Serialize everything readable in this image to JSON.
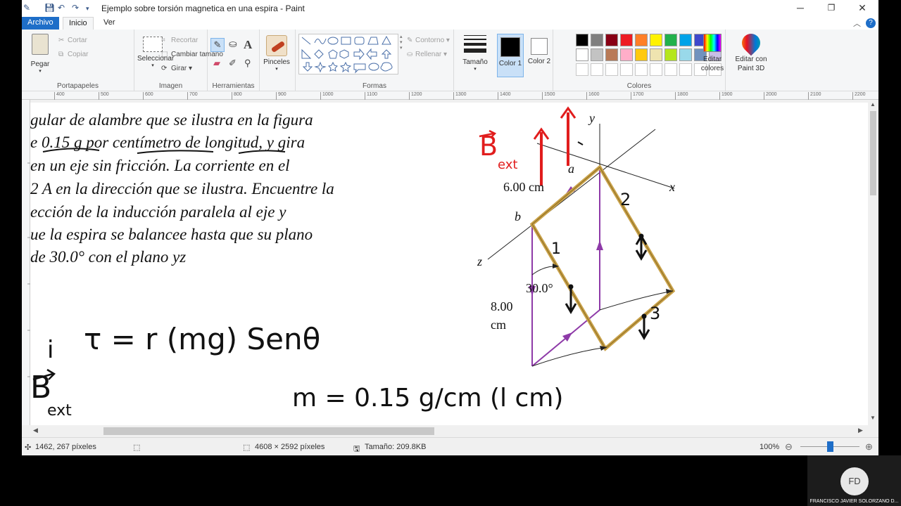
{
  "window": {
    "title": "Ejemplo sobre torsión magnetica en una espira - Paint",
    "minimize": "─",
    "maximize": "❐",
    "close": "✕"
  },
  "tabs": [
    "Archivo",
    "Inicio",
    "Ver"
  ],
  "ribbon": {
    "portapapeles": {
      "label": "Portapapeles",
      "pegar": "Pegar",
      "cortar": "Cortar",
      "copiar": "Copiar"
    },
    "imagen": {
      "label": "Imagen",
      "seleccionar": "Seleccionar",
      "recortar": "Recortar",
      "cambiar_tamano": "Cambiar tamaño",
      "girar": "Girar"
    },
    "herramientas": {
      "label": "Herramientas"
    },
    "pinceles": "Pinceles",
    "formas": {
      "label": "Formas",
      "contorno": "Contorno",
      "rellenar": "Rellenar"
    },
    "tamano": "Tamaño",
    "color1": "Color 1",
    "color2": "Color 2",
    "colores": {
      "label": "Colores",
      "editar_colores": "Editar colores"
    },
    "paint3d": "Editar con Paint 3D"
  },
  "palette": [
    "#000000",
    "#7f7f7f",
    "#880015",
    "#ed1c24",
    "#ff7f27",
    "#fff200",
    "#22b14c",
    "#00a2e8",
    "#3f48cc",
    "#a349a4",
    "#ffffff",
    "#c3c3c3",
    "#b97a57",
    "#ffaec9",
    "#ffc90e",
    "#efe4b0",
    "#b5e61d",
    "#99d9ea",
    "#7092be",
    "#c8bfe7"
  ],
  "ruler": [
    "400",
    "500",
    "600",
    "700",
    "800",
    "900",
    "1000",
    "1100",
    "1200",
    "1300",
    "1400",
    "1500",
    "1600",
    "1700",
    "1800",
    "1900",
    "2000",
    "2100",
    "2200"
  ],
  "problem": {
    "line1": "gular de alambre que se ilustra en la figura",
    "line2": "e 0.15 g por centímetro de longitud, y gira",
    "line3": "en un eje sin fricción. La corriente en el",
    "line4": "2 A en la dirección que se ilustra. Encuentre la",
    "line5": "ección de  la inducción        paralela al eje y",
    "line6": "ue la espira se balancee hasta que su plano",
    "line7": "de 30.0° con el plano yz"
  },
  "figure": {
    "y": "y",
    "x": "x",
    "z": "z",
    "a": "a",
    "b": "b",
    "dim1": "6.00 cm",
    "dim2a": "8.00",
    "dim2b": "cm",
    "angle": "30.0°",
    "bext_b": "B",
    "bext_sub": "ext",
    "n1": "1",
    "n2": "2",
    "n3": "3"
  },
  "handwriting": {
    "torque": "τ = r (mg) Senθ",
    "bullet": "i",
    "bext_b": "B",
    "bext_sub": "ext",
    "mass": "m = 0.15 g/cm (l cm)"
  },
  "status": {
    "pos": "1462, 267 píxeles",
    "dims": "4608 × 2592 píxeles",
    "size": "Tamaño: 209.8KB",
    "zoom": "100%",
    "zoom_level": 0.5
  },
  "presenter": {
    "initials": "FD",
    "name": "FRANCISCO JAVIER SOLORZANO D..."
  }
}
